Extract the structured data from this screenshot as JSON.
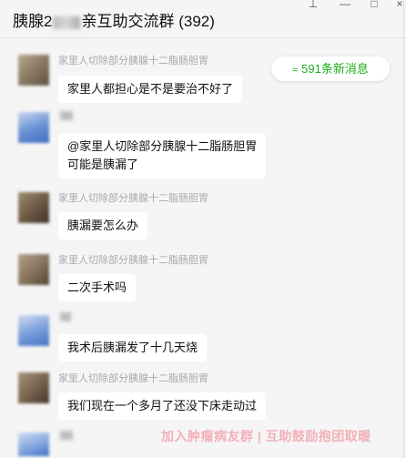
{
  "window": {
    "title_prefix": "胰腺2",
    "title_middle": "亲互助交流群",
    "member_count": "(392)",
    "controls": {
      "pin": "⊥",
      "minimize": "—",
      "maximize": "□",
      "close": "×"
    }
  },
  "new_messages_badge": {
    "icon": "chevron-double-up-icon",
    "text": "591条新消息",
    "color": "#1aad19"
  },
  "messages": [
    {
      "sender": "家里人切除部分胰腺十二脂肠胆胃",
      "text": "家里人都担心是不是要治不好了"
    },
    {
      "sender": "",
      "text": "@家里人切除部分胰腺十二脂肠胆胃\n可能是胰漏了"
    },
    {
      "sender": "家里人切除部分胰腺十二脂肠胆胃",
      "text": "胰漏要怎么办"
    },
    {
      "sender": "家里人切除部分胰腺十二脂肠胆胃",
      "text": "二次手术吗"
    },
    {
      "sender": "",
      "text": "我术后胰漏发了十几天烧"
    },
    {
      "sender": "家里人切除部分胰腺十二脂肠胆胃",
      "text": "我们现在一个多月了还没下床走动过"
    }
  ],
  "watermark": "加入肿瘤病友群 | 互助鼓励抱团取暖"
}
